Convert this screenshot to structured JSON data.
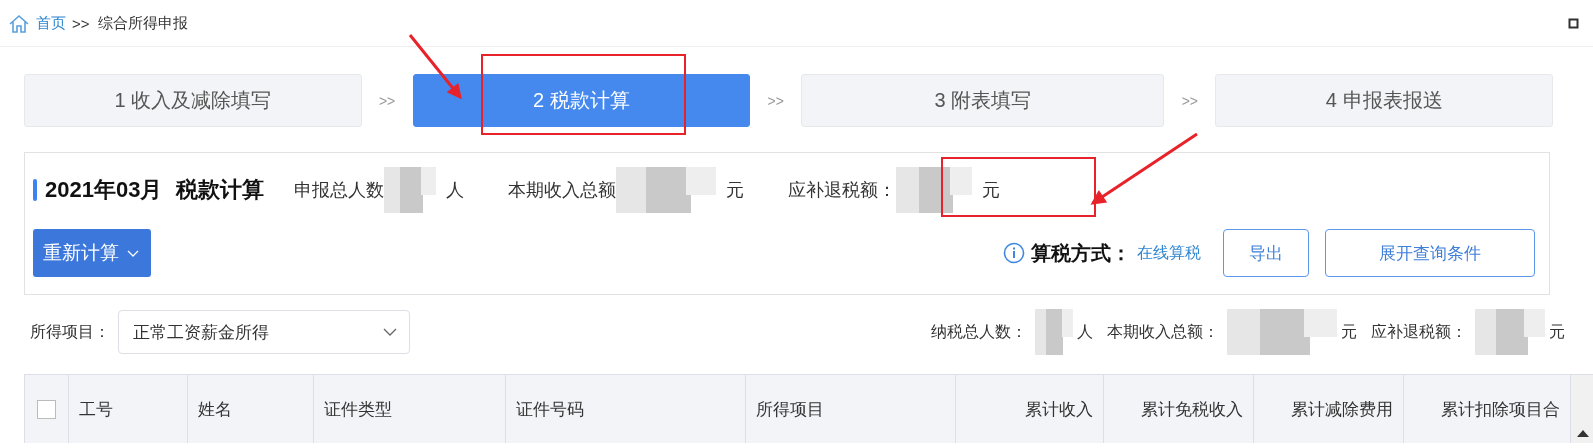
{
  "breadcrumb": {
    "home": "首页",
    "separator": ">>",
    "current": "综合所得申报"
  },
  "steps": [
    {
      "label": "1 收入及减除填写",
      "selected": false
    },
    {
      "label": "2 税款计算",
      "selected": true
    },
    {
      "label": "3 附表填写",
      "selected": false
    },
    {
      "label": "4 申报表报送",
      "selected": false
    }
  ],
  "step_separator": ">>",
  "summary": {
    "period": "2021年03月",
    "title": "税款计算",
    "stats": [
      {
        "label": "申报总人数",
        "unit": "人"
      },
      {
        "label": "本期收入总额",
        "unit": "元"
      },
      {
        "label": "应补退税额：",
        "unit": "元"
      }
    ],
    "recalc_button": "重新计算",
    "method_label": "算税方式：",
    "method_value": "在线算税",
    "export_button": "导出",
    "expand_button": "展开查询条件"
  },
  "filter": {
    "label": "所得项目：",
    "value": "正常工资薪金所得",
    "stats": [
      {
        "label": "纳税总人数：",
        "unit": "人"
      },
      {
        "label": "本期收入总额：",
        "unit": "元"
      },
      {
        "label": "应补退税额：",
        "unit": "元"
      }
    ]
  },
  "table": {
    "select_all_checked": false,
    "columns": [
      {
        "label": "工号",
        "kind": "text"
      },
      {
        "label": "姓名",
        "kind": "text"
      },
      {
        "label": "证件类型",
        "kind": "text"
      },
      {
        "label": "证件号码",
        "kind": "text"
      },
      {
        "label": "所得项目",
        "kind": "text"
      },
      {
        "label": "累计收入",
        "kind": "amount"
      },
      {
        "label": "累计免税收入",
        "kind": "amount"
      },
      {
        "label": "累计减除费用",
        "kind": "amount"
      },
      {
        "label": "累计扣除项目合",
        "kind": "amount"
      }
    ]
  },
  "annotations": [
    {
      "kind": "box"
    },
    {
      "kind": "box"
    },
    {
      "kind": "arrow"
    },
    {
      "kind": "arrow"
    }
  ]
}
